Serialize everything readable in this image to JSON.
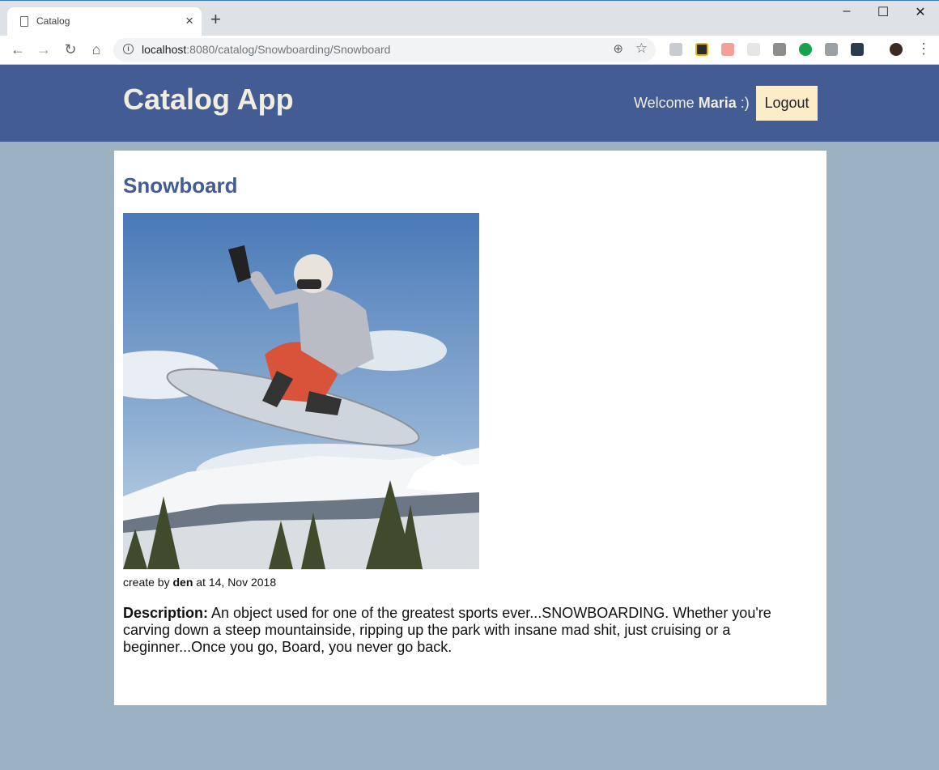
{
  "browser": {
    "tab_title": "Catalog",
    "url_host": "localhost",
    "url_rest": ":8080/catalog/Snowboarding/Snowboard",
    "window_controls": [
      "minimize",
      "maximize",
      "close"
    ]
  },
  "header": {
    "brand": "Catalog App",
    "welcome_prefix": "Welcome",
    "username": "Maria",
    "welcome_suffix": ":)",
    "logout_label": "Logout"
  },
  "item": {
    "title": "Snowboard",
    "created_prefix": "create by",
    "author": "den",
    "created_mid": "at",
    "created_date": "14, Nov 2018",
    "description_label": "Description:",
    "description_text": "An object used for one of the greatest sports ever...SNOWBOARDING. Whether you're carving down a steep mountainside, ripping up the park with insane mad shit, just cruising or a beginner...Once you go, Board, you never go back."
  },
  "colors": {
    "header_bg": "#435d94",
    "page_bg": "#9cb1c1",
    "logout_bg": "#fdecc8",
    "title_color": "#435d94"
  }
}
